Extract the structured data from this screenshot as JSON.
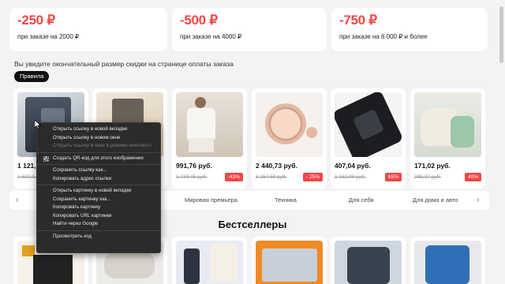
{
  "promos": [
    {
      "amount": "-250 ₽",
      "condition": "при заказе на 2000 ₽"
    },
    {
      "amount": "-500 ₽",
      "condition": "при заказе на 4000 ₽"
    },
    {
      "amount": "-750 ₽",
      "condition": "при заказе на 6 000 ₽ и более"
    }
  ],
  "note": "Вы увидите окончательный размер скидки на странице оплаты заказа",
  "rules_label": "Правила",
  "products": [
    {
      "price": "1 121,…",
      "old": "1 602,0…",
      "discount": ""
    },
    {
      "price": "",
      "old": "",
      "discount": ""
    },
    {
      "price": "991,76 руб.",
      "old": "1 739,45 руб.",
      "discount": "-43%"
    },
    {
      "price": "2 440,73 руб.",
      "old": "3 254,59 руб.",
      "discount": "- 25%"
    },
    {
      "price": "407,04 руб.",
      "old": "1 162,98 руб.",
      "discount": "65%"
    },
    {
      "price": "171,02 руб.",
      "old": "285,37 руб.",
      "discount": "40%"
    }
  ],
  "categories": {
    "prev_icon": "chevron-left-icon",
    "next_icon": "chevron-right-icon",
    "items": [
      "Мировая премьера",
      "Техника",
      "Для себя",
      "Для дома и авто"
    ]
  },
  "section_title": "Бестселлеры",
  "context_menu": {
    "items": [
      {
        "label": "Открыть ссылку в новой вкладке",
        "disabled": false
      },
      {
        "label": "Открыть ссылку в новом окне",
        "disabled": false
      },
      {
        "label": "Открыть ссылку в окне в режиме инкогнито",
        "disabled": true
      },
      {
        "label": "Создать QR-код для этого изображения",
        "disabled": false,
        "icon": "qr-code-icon"
      },
      {
        "label": "Сохранить ссылку как...",
        "disabled": false
      },
      {
        "label": "Копировать адрес ссылки",
        "disabled": false
      },
      {
        "label": "Открыть картинку в новой вкладке",
        "disabled": false
      },
      {
        "label": "Сохранить картинку как...",
        "disabled": false
      },
      {
        "label": "Копировать картинку",
        "disabled": false
      },
      {
        "label": "Копировать URL картинки",
        "disabled": false
      },
      {
        "label": "Найти через Google",
        "disabled": false
      },
      {
        "label": "Просмотреть код",
        "disabled": false
      }
    ]
  },
  "colors": {
    "accent": "#f54646",
    "background": "#f3f3f4",
    "menu_bg": "#2b2b2b"
  }
}
